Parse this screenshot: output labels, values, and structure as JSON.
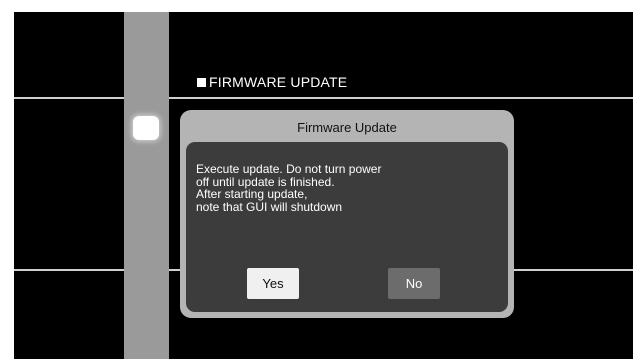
{
  "section": {
    "title": "FIRMWARE UPDATE",
    "bullet_icon": "square-bullet-icon"
  },
  "dialog": {
    "title": "Firmware Update",
    "message_lines": [
      "Execute update. Do not turn power",
      "off until update is finished.",
      "After starting update,",
      "note that GUI will shutdown"
    ],
    "buttons": {
      "yes_label": "Yes",
      "no_label": "No",
      "focused": "Yes"
    }
  },
  "colors": {
    "screen_background": "#000000",
    "dialog_frame": "#b4b4b4",
    "dialog_body": "#3c3c3c",
    "button_focused": "#f0f0f0",
    "button_unfocused": "#6c6c6c",
    "side_bar": "#9a9a9a"
  }
}
